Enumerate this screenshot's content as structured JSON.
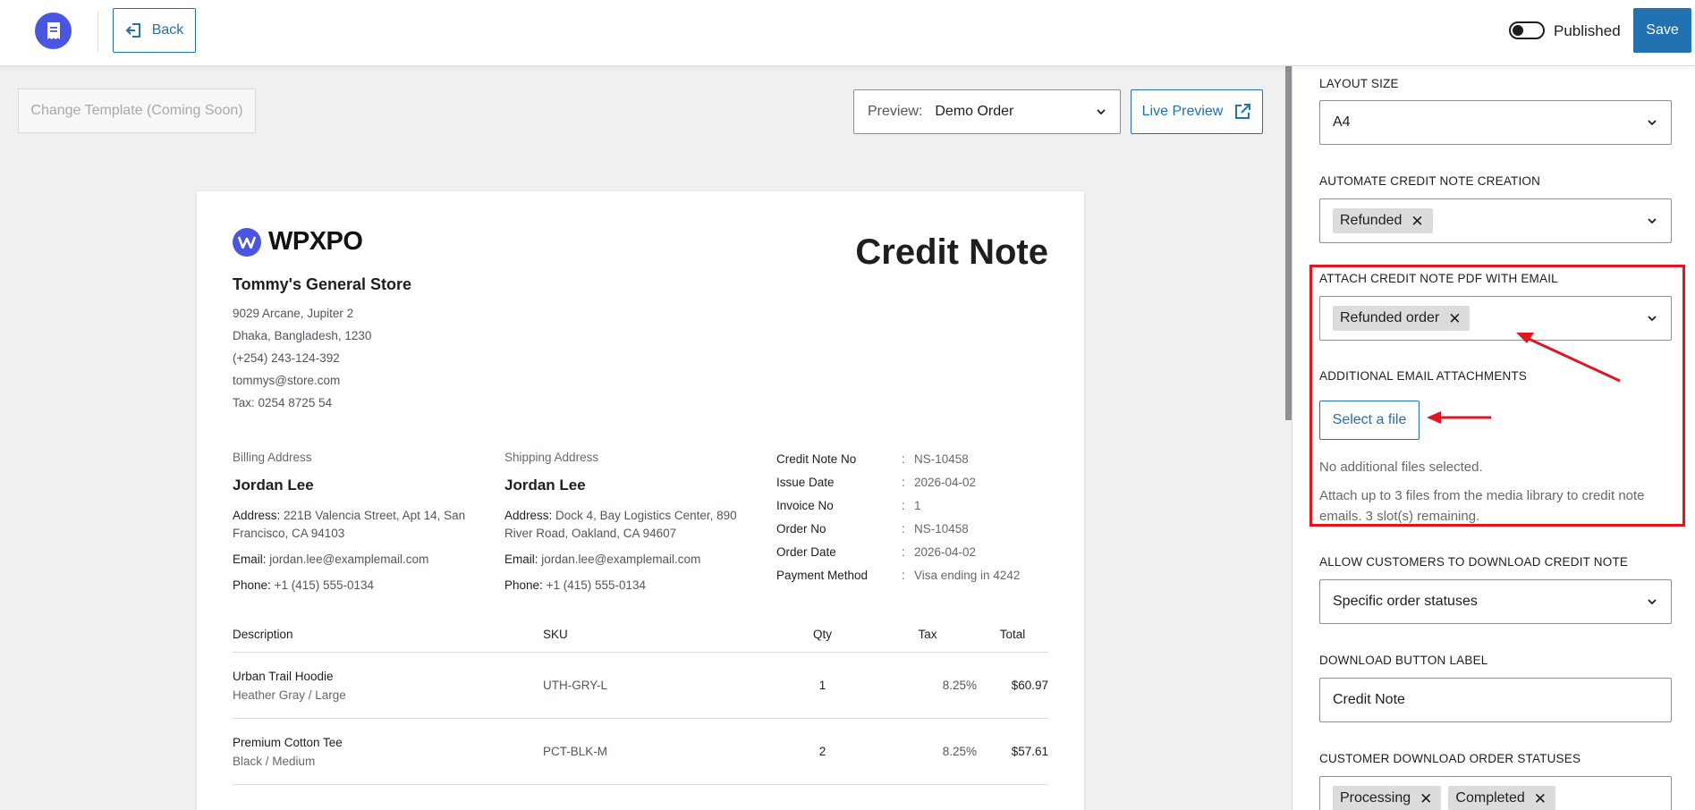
{
  "header": {
    "back_label": "Back",
    "published_label": "Published",
    "published_on": false,
    "save_label": "Save"
  },
  "toolbar": {
    "change_template_label": "Change Template (Coming Soon)",
    "preview_label": "Preview:",
    "preview_value": "Demo Order",
    "live_preview_label": "Live Preview"
  },
  "document": {
    "brand": "WPXPO",
    "title": "Credit Note",
    "store": {
      "name": "Tommy's General Store",
      "lines": [
        "9029 Arcane, Jupiter 2",
        "Dhaka, Bangladesh, 1230",
        "(+254) 243-124-392",
        "tommys@store.com",
        "Tax: 0254 8725 54"
      ]
    },
    "billing": {
      "heading": "Billing Address",
      "name": "Jordan Lee",
      "address_key": "Address:",
      "address": "221B Valencia Street, Apt 14, San Francisco, CA 94103",
      "email_key": "Email:",
      "email": "jordan.lee@examplemail.com",
      "phone_key": "Phone:",
      "phone": "+1 (415) 555-0134"
    },
    "shipping": {
      "heading": "Shipping Address",
      "name": "Jordan Lee",
      "address_key": "Address:",
      "address": "Dock 4, Bay Logistics Center, 890 River Road, Oakland, CA 94607",
      "email_key": "Email:",
      "email": "jordan.lee@examplemail.com",
      "phone_key": "Phone:",
      "phone": "+1 (415) 555-0134"
    },
    "meta": [
      {
        "key": "Credit Note No",
        "sep": ":",
        "value": "NS-10458"
      },
      {
        "key": "Issue Date",
        "sep": ":",
        "value": "2026-04-02"
      },
      {
        "key": "Invoice No",
        "sep": ":",
        "value": "1"
      },
      {
        "key": "Order No",
        "sep": ":",
        "value": "NS-10458"
      },
      {
        "key": "Order Date",
        "sep": ":",
        "value": "2026-04-02"
      },
      {
        "key": "Payment Method",
        "sep": ":",
        "value": "Visa ending in 4242"
      }
    ],
    "columns": [
      "Description",
      "SKU",
      "Qty",
      "Tax",
      "Total"
    ],
    "items": [
      {
        "name": "Urban Trail Hoodie",
        "variant": "Heather Gray / Large",
        "sku": "UTH-GRY-L",
        "qty": "1",
        "tax": "8.25%",
        "total": "$60.97"
      },
      {
        "name": "Premium Cotton Tee",
        "variant": "Black / Medium",
        "sku": "PCT-BLK-M",
        "qty": "2",
        "tax": "8.25%",
        "total": "$57.61"
      }
    ]
  },
  "settings": {
    "layout_size": {
      "label": "LAYOUT SIZE",
      "value": "A4"
    },
    "automate": {
      "label": "AUTOMATE CREDIT NOTE CREATION",
      "chips": [
        "Refunded"
      ]
    },
    "attach": {
      "label": "ATTACH CREDIT NOTE PDF WITH EMAIL",
      "chips": [
        "Refunded order"
      ]
    },
    "additional": {
      "label": "ADDITIONAL EMAIL ATTACHMENTS",
      "button": "Select a file",
      "status": "No additional files selected.",
      "help": "Attach up to 3 files from the media library to credit note emails. 3 slot(s) remaining."
    },
    "allow_download": {
      "label": "ALLOW CUSTOMERS TO DOWNLOAD CREDIT NOTE",
      "value": "Specific order statuses"
    },
    "download_label": {
      "label": "DOWNLOAD BUTTON LABEL",
      "value": "Credit Note"
    },
    "download_statuses": {
      "label": "CUSTOMER DOWNLOAD ORDER STATUSES",
      "chips": [
        "Processing",
        "Completed"
      ]
    },
    "chip_remove_glyph": "✕"
  },
  "colors": {
    "accent": "#2271b1",
    "brand": "#4a56e2",
    "highlight": "#e0151f"
  }
}
